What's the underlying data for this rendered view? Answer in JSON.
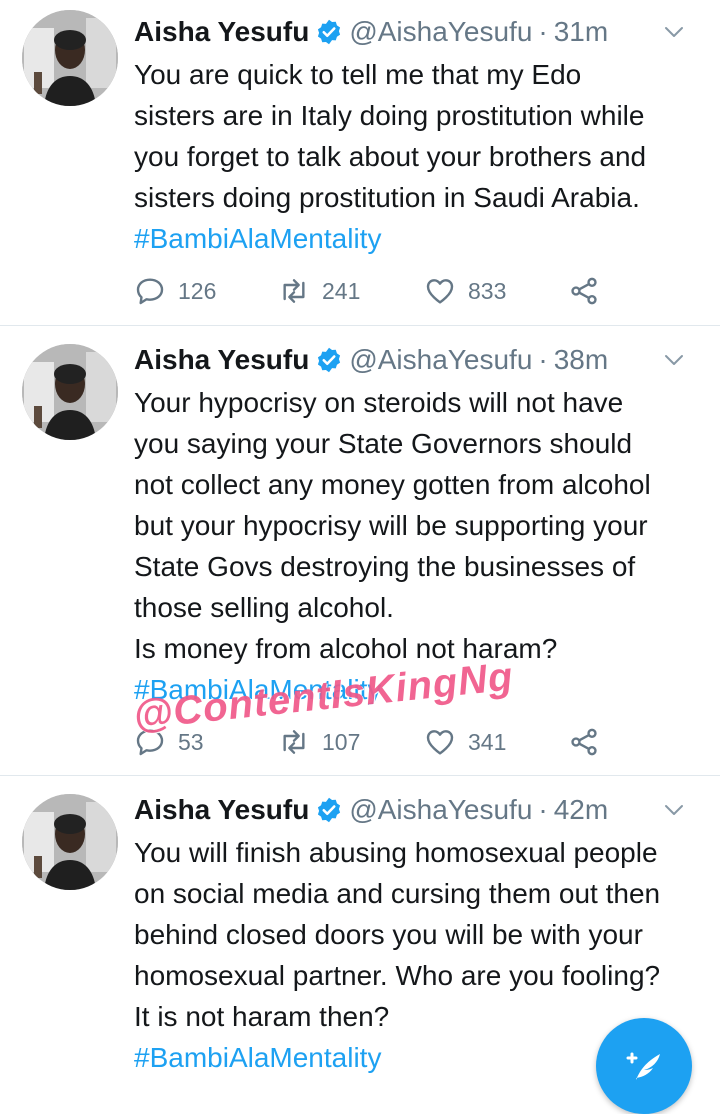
{
  "tweets": [
    {
      "name": "Aisha Yesufu",
      "handle": "@AishaYesufu",
      "separator": "·",
      "time": "31m",
      "lines": [
        "You are quick to tell me that my Edo",
        "sisters are in Italy doing prostitution while",
        "you forget to talk about your brothers and",
        "sisters doing prostitution in Saudi Arabia."
      ],
      "hashtag": "#BambiAlaMentality",
      "replies": "126",
      "retweets": "241",
      "likes": "833"
    },
    {
      "name": "Aisha Yesufu",
      "handle": "@AishaYesufu",
      "separator": "·",
      "time": "38m",
      "lines": [
        "Your hypocrisy on steroids will not have",
        "you saying your State Governors should",
        "not collect any money gotten from alcohol",
        "but your hypocrisy will be supporting your",
        "State Govs destroying the businesses of",
        "those selling alcohol.",
        "Is money from alcohol not haram?"
      ],
      "hashtag": "#BambiAlaMentality",
      "replies": "53",
      "retweets": "107",
      "likes": "341"
    },
    {
      "name": "Aisha Yesufu",
      "handle": "@AishaYesufu",
      "separator": "·",
      "time": "42m",
      "lines": [
        "You will finish abusing homosexual people",
        "on social media and cursing them out then",
        "behind closed doors you will be with your",
        "homosexual partner. Who are you fooling?",
        "It is not haram then?"
      ],
      "hashtag": "#BambiAlaMentality"
    }
  ],
  "watermark": "@ContentIsKingNg",
  "colors": {
    "accent": "#1da1f2",
    "muted": "#657786",
    "text": "#14171a",
    "watermark": "#f05a8a"
  },
  "icons": {
    "reply": "reply-icon",
    "retweet": "retweet-icon",
    "like": "heart-icon",
    "share": "share-icon",
    "verified": "verified-badge-icon",
    "caret": "chevron-down-icon",
    "compose": "compose-tweet-icon"
  }
}
